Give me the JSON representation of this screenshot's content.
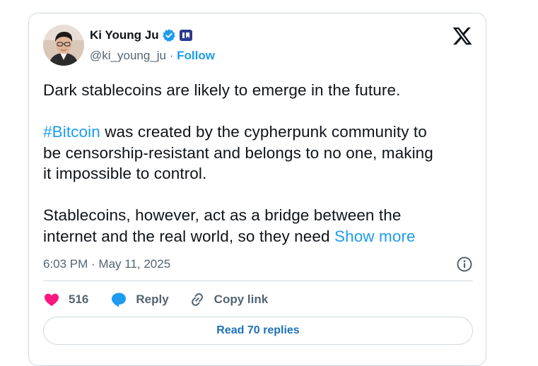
{
  "author": {
    "name": "Ki Young Ju",
    "handle": "@ki_young_ju",
    "separator": "·",
    "follow_label": "Follow",
    "icons": {
      "avatar": "profile-photo",
      "verified": "verified-badge-icon",
      "affiliation": "affiliation-badge-icon"
    }
  },
  "tweet": {
    "para1": "Dark stablecoins are likely to emerge in the future.",
    "hashtag": "#Bitcoin",
    "para2_rest": " was created by the cypherpunk community to\nbe censorship-resistant and belongs to no one, making\nit impossible to control.",
    "para3": "Stablecoins, however, act as a bridge between the\ninternet and the real world, so they need ",
    "show_more": "Show more"
  },
  "meta": {
    "timestamp": "6:03 PM · May 11, 2025"
  },
  "actions": {
    "like_count": "516",
    "reply_label": "Reply",
    "copy_label": "Copy link"
  },
  "read_replies_label": "Read 70 replies",
  "colors": {
    "accent": "#1d9bf0",
    "like": "#f91880",
    "text": "#0f1419",
    "muted": "#536471",
    "border": "#cfd9de"
  }
}
